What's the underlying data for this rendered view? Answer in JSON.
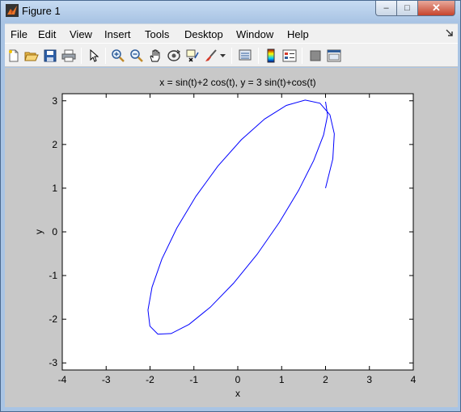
{
  "window": {
    "title": "Figure 1",
    "controls": {
      "minimize": "–",
      "maximize": "□",
      "close": "✕"
    }
  },
  "menubar": {
    "items": [
      {
        "label": "File"
      },
      {
        "label": "Edit"
      },
      {
        "label": "View"
      },
      {
        "label": "Insert"
      },
      {
        "label": "Tools"
      },
      {
        "label": "Desktop"
      },
      {
        "label": "Window"
      },
      {
        "label": "Help"
      }
    ],
    "overflow_icon": "dock-arrow-icon"
  },
  "toolbar": {
    "icons": [
      "new-figure-icon",
      "open-file-icon",
      "save-icon",
      "print-icon",
      "edit-plot-arrow-icon",
      "zoom-in-icon",
      "zoom-out-icon",
      "pan-hand-icon",
      "rotate-3d-icon",
      "data-cursor-icon",
      "brush-icon",
      "link-plot-icon",
      "insert-colorbar-icon",
      "insert-legend-icon",
      "hide-plot-tools-icon",
      "show-plot-tools-icon"
    ]
  },
  "colors": {
    "curve": "#0000ff",
    "figure_background": "#c8c8c8",
    "axes_background": "#ffffff"
  },
  "chart_data": {
    "type": "line",
    "title": "x = sin(t)+2 cos(t), y = 3 sin(t)+cos(t)",
    "xlabel": "x",
    "ylabel": "y",
    "xlim": [
      -4,
      4
    ],
    "ylim": [
      -3.162,
      3.162
    ],
    "xticks": [
      -4,
      -3,
      -2,
      -1,
      0,
      1,
      2,
      3,
      4
    ],
    "yticks": [
      -3,
      -2,
      -1,
      0,
      1,
      2,
      3
    ],
    "grid": false,
    "legend": "none",
    "series": [
      {
        "x": [
          2.0,
          2.166,
          2.2,
          2.1,
          1.874,
          1.536,
          1.107,
          0.612,
          0.08,
          -0.455,
          -0.955,
          -1.389,
          -1.73,
          -1.954,
          -2.047,
          -2.003,
          -1.822,
          -1.519,
          -1.111,
          -0.627,
          -0.097,
          0.442,
          0.947,
          1.386,
          1.73,
          1.956,
          2.047,
          2.0
        ],
        "y": [
          1.0,
          1.67,
          2.244,
          2.68,
          2.944,
          3.017,
          2.894,
          2.583,
          2.108,
          1.503,
          0.813,
          0.087,
          -0.623,
          -1.265,
          -1.79,
          -2.158,
          -2.342,
          -2.328,
          -2.118,
          -1.725,
          -1.177,
          -0.513,
          0.217,
          0.949,
          1.633,
          2.22,
          2.669,
          2.979
        ]
      }
    ]
  }
}
